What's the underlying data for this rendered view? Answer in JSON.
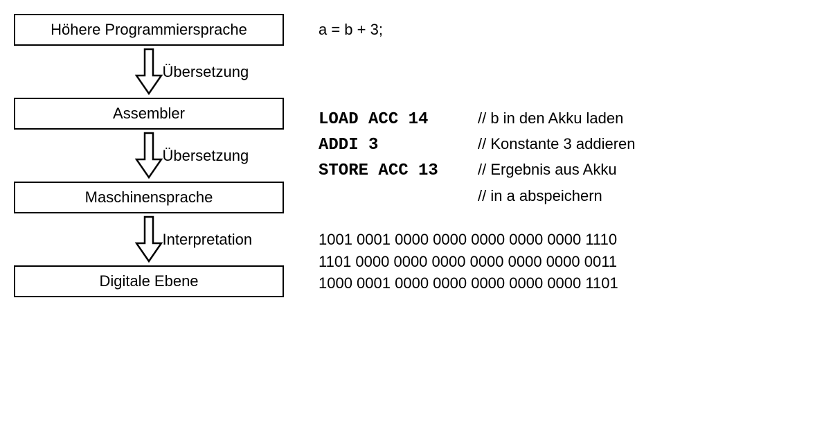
{
  "boxes": {
    "hll": "Höhere Programmiersprache",
    "asm": "Assembler",
    "machine": "Maschinensprache",
    "digital": "Digitale Ebene"
  },
  "arrows": {
    "a1": "Übersetzung",
    "a2": "Übersetzung",
    "a3": "Interpretation"
  },
  "hll_code": "a = b + 3;",
  "asm_lines": [
    {
      "code": "LOAD ACC 14",
      "comment": "// b in den Akku laden"
    },
    {
      "code": "ADDI 3",
      "comment": "// Konstante 3 addieren"
    },
    {
      "code": "STORE ACC 13",
      "comment": "// Ergebnis aus Akku"
    },
    {
      "code": "",
      "comment": "// in a abspeichern"
    }
  ],
  "machine_lines": {
    "m1": "1001 0001 0000 0000 0000 0000 0000 1110",
    "m2": "1101 0000 0000 0000 0000 0000 0000 0011",
    "m3": "1000 0001 0000 0000 0000 0000 0000 1101"
  }
}
